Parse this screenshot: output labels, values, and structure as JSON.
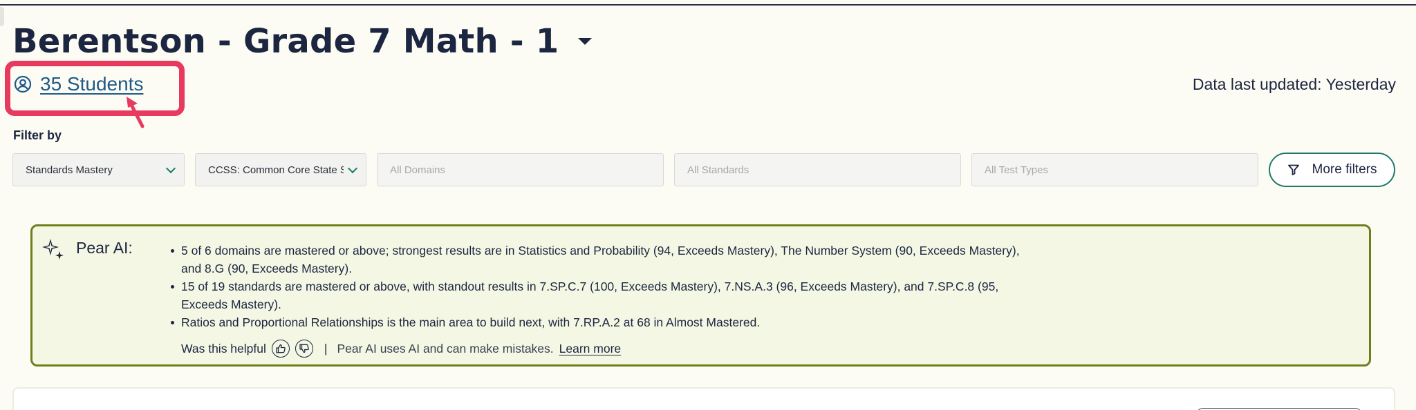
{
  "header": {
    "title": "Berentson - Grade 7 Math - 1",
    "students_label": "35 Students",
    "data_updated": "Data last updated: Yesterday"
  },
  "filters": {
    "label": "Filter by",
    "report_type": "Standards Mastery",
    "standard_set": "CCSS: Common Core State Standards",
    "domains_placeholder": "All Domains",
    "standards_placeholder": "All Standards",
    "test_types_placeholder": "All Test Types",
    "more_filters_label": "More filters"
  },
  "ai_panel": {
    "title": "Pear AI:",
    "insights": [
      "5 of 6 domains are mastered or above; strongest results are in Statistics and Probability (94, Exceeds Mastery), The Number System (90, Exceeds Mastery), and 8.G (90, Exceeds Mastery).",
      "15 of 19 standards are mastered or above, with standout results in 7.SP.C.7 (100, Exceeds Mastery), 7.NS.A.3 (96, Exceeds Mastery), and 7.SP.C.8 (95, Exceeds Mastery).",
      "Ratios and Proportional Relationships is the main area to build next, with 7.RP.A.2 at 68 in Almost Mastered."
    ],
    "helpful_prompt": "Was this helpful",
    "separator": "|",
    "disclaimer": "Pear AI uses AI and can make mistakes.",
    "learn_more": "Learn more"
  },
  "icons": {
    "title_dropdown": "caret-down-icon",
    "students": "user-circle-icon",
    "filter_chevron": "chevron-down-icon",
    "more_filters": "funnel-icon",
    "ai": "sparkle-icon",
    "thumbs_up": "thumbs-up-icon",
    "thumbs_down": "thumbs-down-icon"
  },
  "colors": {
    "background": "#fdfcf4",
    "text": "#1d2640",
    "link": "#1f5a88",
    "accent_teal": "#1b7a6a",
    "ai_border": "#6f7e19",
    "ai_background": "#f3f7e4",
    "annotation": "#e8395f"
  }
}
